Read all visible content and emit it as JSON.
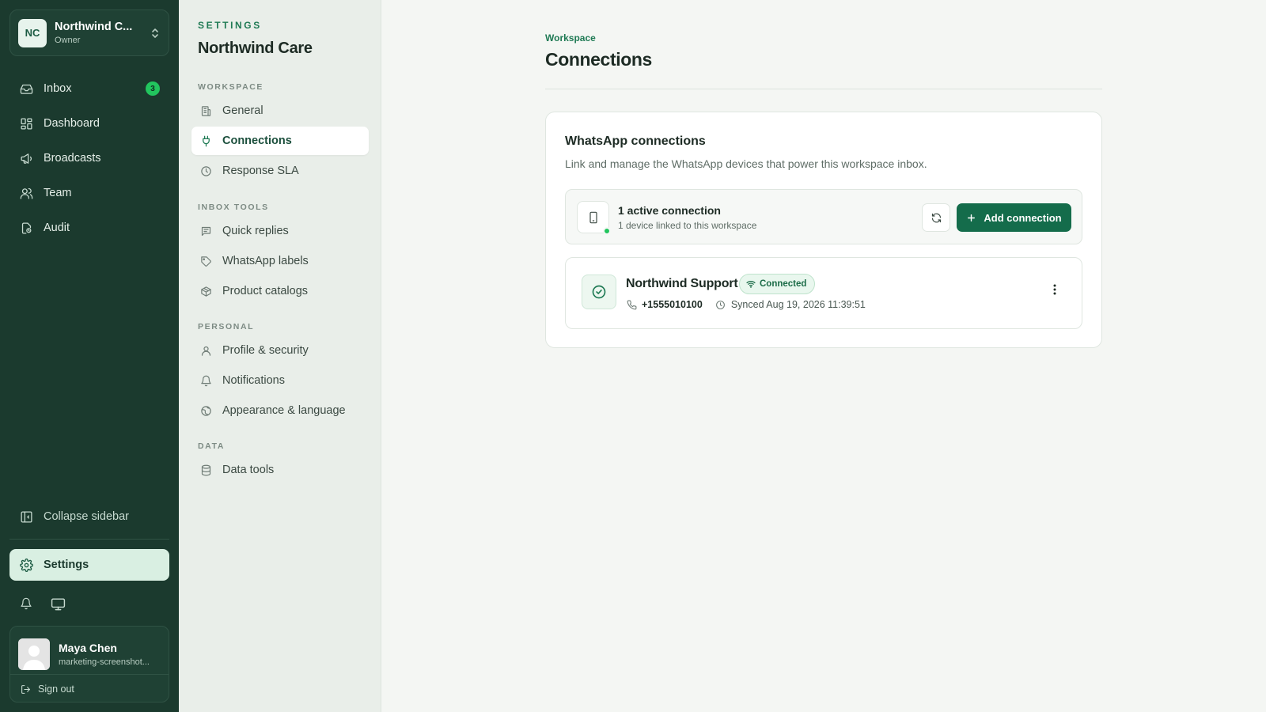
{
  "workspace": {
    "initials": "NC",
    "name": "Northwind C...",
    "role": "Owner"
  },
  "nav": {
    "items": [
      {
        "label": "Inbox",
        "badge": "3"
      },
      {
        "label": "Dashboard"
      },
      {
        "label": "Broadcasts"
      },
      {
        "label": "Team"
      },
      {
        "label": "Audit"
      }
    ],
    "collapse_label": "Collapse sidebar",
    "settings_label": "Settings"
  },
  "user": {
    "name": "Maya Chen",
    "email": "marketing-screenshot...",
    "signout_label": "Sign out"
  },
  "settings_nav": {
    "eyebrow": "SETTINGS",
    "title": "Northwind Care",
    "sections": [
      {
        "heading": "WORKSPACE",
        "items": [
          "General",
          "Connections",
          "Response SLA"
        ]
      },
      {
        "heading": "INBOX TOOLS",
        "items": [
          "Quick replies",
          "WhatsApp labels",
          "Product catalogs"
        ]
      },
      {
        "heading": "PERSONAL",
        "items": [
          "Profile & security",
          "Notifications",
          "Appearance & language"
        ]
      },
      {
        "heading": "DATA",
        "items": [
          "Data tools"
        ]
      }
    ],
    "active_item": "Connections"
  },
  "page": {
    "breadcrumb": "Workspace",
    "title": "Connections"
  },
  "panel": {
    "title": "WhatsApp connections",
    "description": "Link and manage the WhatsApp devices that power this workspace inbox.",
    "summary": {
      "title": "1 active connection",
      "subtitle": "1 device linked to this workspace",
      "add_label": "Add connection"
    },
    "connection": {
      "name": "Northwind Support",
      "status": "Connected",
      "phone": "+1555010100",
      "synced": "Synced Aug 19, 2026 11:39:51"
    }
  },
  "colors": {
    "sidebar_bg": "#1b3a2e",
    "accent": "#146c4b",
    "status_green": "#22c55e"
  }
}
